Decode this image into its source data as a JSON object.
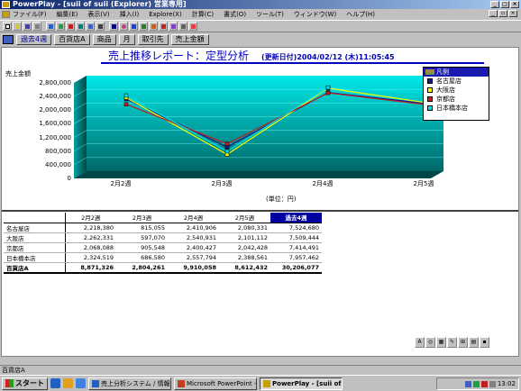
{
  "window": {
    "title": "PowerPlay - [suii of suii (Explorer) 営業専用]"
  },
  "menu": [
    "ファイル(F)",
    "編集(E)",
    "表示(V)",
    "挿入(I)",
    "Explore(X)",
    "計算(C)",
    "書式(O)",
    "ツール(T)",
    "ウィンドウ(W)",
    "ヘルプ(H)"
  ],
  "dimensions": [
    "過去4週",
    "百貨店A",
    "商品",
    "月",
    "取引先",
    "売上金額"
  ],
  "report": {
    "title": "売上推移レポート：定型分析",
    "updated": "(更新日付)2004/02/12 (木)11:05:45",
    "y_axis_label": "売上金額",
    "unit": "(単位：円)"
  },
  "legend": {
    "title": "凡例",
    "items": [
      {
        "name": "名古屋店",
        "color": "#1a1a80"
      },
      {
        "name": "大阪店",
        "color": "#ffff00"
      },
      {
        "name": "京都店",
        "color": "#c02020"
      },
      {
        "name": "日本橋本店",
        "color": "#00e0e0"
      }
    ]
  },
  "chart_data": {
    "type": "line",
    "categories": [
      "2月2週",
      "2月3週",
      "2月4週",
      "2月5週"
    ],
    "ylim": [
      0,
      2800000
    ],
    "yticks": [
      "2,800,000",
      "2,400,000",
      "2,000,000",
      "1,600,000",
      "1,200,000",
      "800,000",
      "400,000",
      "0"
    ],
    "series": [
      {
        "name": "名古屋店",
        "values": [
          2218380,
          815055,
          2410906,
          2080331
        ],
        "color": "#1a1a80"
      },
      {
        "name": "大阪店",
        "values": [
          2262331,
          597070,
          2540931,
          2101112
        ],
        "color": "#ffff00"
      },
      {
        "name": "京都店",
        "values": [
          2068088,
          905548,
          2400427,
          2042428
        ],
        "color": "#c02020"
      },
      {
        "name": "日本橋本店",
        "values": [
          2324519,
          686580,
          2557794,
          2388561
        ],
        "color": "#00e0e0"
      }
    ],
    "background": "#008080",
    "grid": true
  },
  "table": {
    "columns": [
      "2月2週",
      "2月3週",
      "2月4週",
      "2月5週",
      "過去4週"
    ],
    "rows": [
      {
        "label": "名古屋店",
        "values": [
          "2,218,380",
          "815,055",
          "2,410,906",
          "2,080,331",
          "7,524,680"
        ]
      },
      {
        "label": "大阪店",
        "values": [
          "2,262,331",
          "597,070",
          "2,540,931",
          "2,101,112",
          "7,509,444"
        ]
      },
      {
        "label": "京都店",
        "values": [
          "2,068,088",
          "905,548",
          "2,400,427",
          "2,042,428",
          "7,414,491"
        ]
      },
      {
        "label": "日本橋本店",
        "values": [
          "2,324,519",
          "686,580",
          "2,557,794",
          "2,388,561",
          "7,957,462"
        ]
      },
      {
        "label": "百貨店A",
        "values": [
          "8,871,326",
          "2,804,261",
          "9,910,058",
          "8,612,432",
          "30,206,077"
        ],
        "total": true
      }
    ]
  },
  "status": "百貨店A",
  "taskbar": {
    "start": "スタート",
    "tasks": [
      "売上分析システム / 情報...",
      "Microsoft PowerPoint - [...",
      "PowerPlay - [suii of..."
    ],
    "clock": "13:02"
  }
}
